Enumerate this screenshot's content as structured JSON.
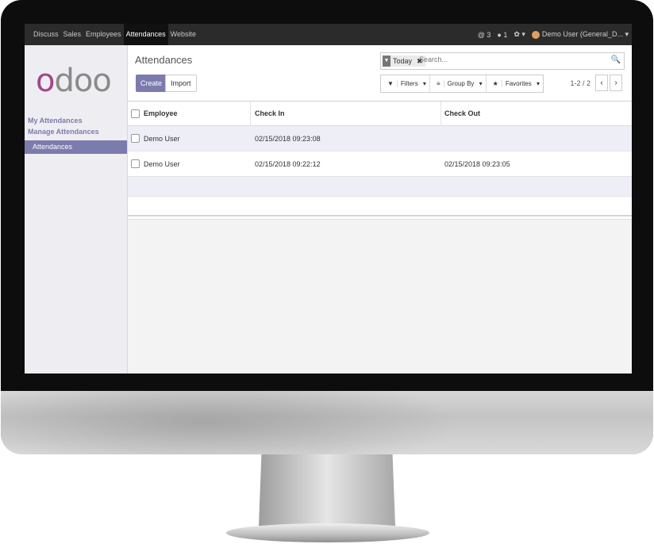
{
  "topbar": {
    "menu": [
      "Discuss",
      "Sales",
      "Employees",
      "Attendances",
      "Website"
    ],
    "active_menu": "Attendances",
    "activity_count": "3",
    "messages_count": "1",
    "user_label": "Demo User (General_D..."
  },
  "sidebar": {
    "logo": "odoo",
    "sections": [
      "My Attendances",
      "Manage Attendances"
    ],
    "active_item": "Attendances"
  },
  "control_panel": {
    "breadcrumb": "Attendances",
    "create_label": "Create",
    "import_label": "Import",
    "search_facet": "Today",
    "search_placeholder": "Search...",
    "filters_label": "Filters",
    "groupby_label": "Group By",
    "favorites_label": "Favorites",
    "pager": "1-2 / 2"
  },
  "table": {
    "columns": [
      "Employee",
      "Check In",
      "Check Out"
    ],
    "rows": [
      {
        "employee": "Demo User",
        "check_in": "02/15/2018 09:23:08",
        "check_out": ""
      },
      {
        "employee": "Demo User",
        "check_in": "02/15/2018 09:22:12",
        "check_out": "02/15/2018 09:23:05"
      }
    ]
  },
  "colors": {
    "accent": "#7c7bad",
    "topbar": "#2b2b2b",
    "logo_primary": "#a24689"
  }
}
